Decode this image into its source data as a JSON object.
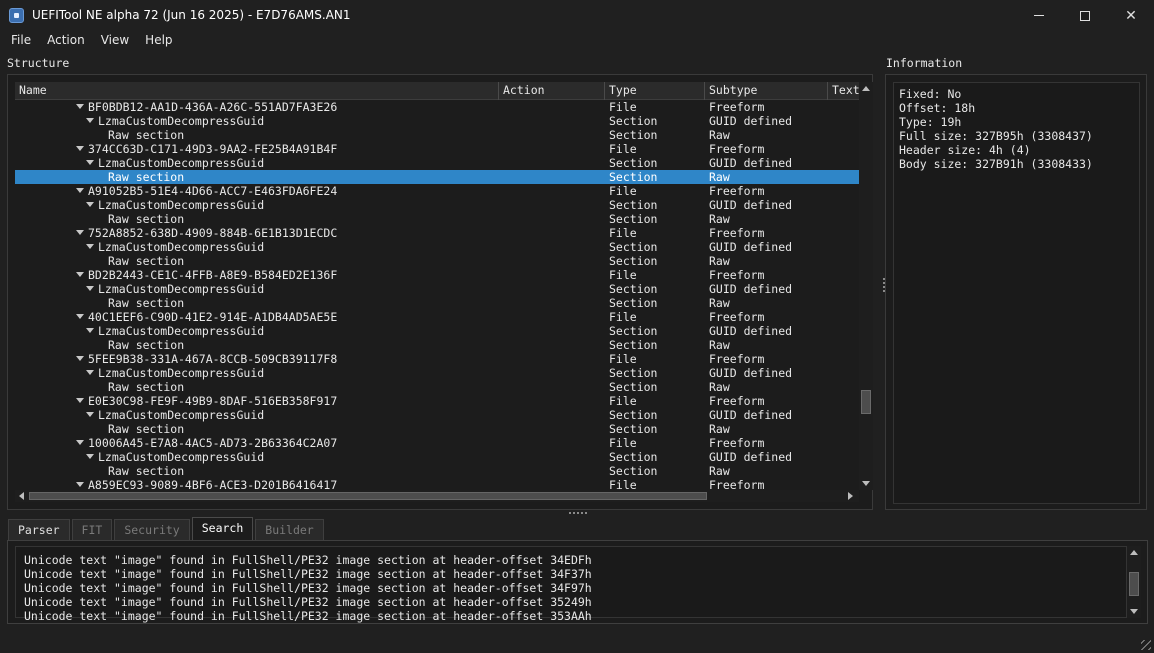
{
  "window": {
    "title": "UEFITool NE alpha 72 (Jun 16 2025) - E7D76AMS.AN1",
    "icon": "uefitool-app-icon",
    "close_glyph": "✕"
  },
  "menu": [
    "File",
    "Action",
    "View",
    "Help"
  ],
  "structure": {
    "label": "Structure",
    "columns": [
      "Name",
      "Action",
      "Type",
      "Subtype",
      "Text"
    ],
    "rows": [
      {
        "level": 1,
        "expanded": true,
        "name": "BF0BDB12-AA1D-436A-A26C-551AD7FA3E26",
        "type": "File",
        "subtype": "Freeform"
      },
      {
        "level": 2,
        "expanded": true,
        "name": "LzmaCustomDecompressGuid",
        "type": "Section",
        "subtype": "GUID defined"
      },
      {
        "level": 3,
        "expanded": false,
        "name": "Raw section",
        "type": "Section",
        "subtype": "Raw"
      },
      {
        "level": 1,
        "expanded": true,
        "name": "374CC63D-C171-49D3-9AA2-FE25B4A91B4F",
        "type": "File",
        "subtype": "Freeform"
      },
      {
        "level": 2,
        "expanded": true,
        "name": "LzmaCustomDecompressGuid",
        "type": "Section",
        "subtype": "GUID defined"
      },
      {
        "level": 3,
        "expanded": false,
        "name": "Raw section",
        "type": "Section",
        "subtype": "Raw",
        "selected": true
      },
      {
        "level": 1,
        "expanded": true,
        "name": "A91052B5-51E4-4D66-ACC7-E463FDA6FE24",
        "type": "File",
        "subtype": "Freeform"
      },
      {
        "level": 2,
        "expanded": true,
        "name": "LzmaCustomDecompressGuid",
        "type": "Section",
        "subtype": "GUID defined"
      },
      {
        "level": 3,
        "expanded": false,
        "name": "Raw section",
        "type": "Section",
        "subtype": "Raw"
      },
      {
        "level": 1,
        "expanded": true,
        "name": "752A8852-638D-4909-884B-6E1B13D1ECDC",
        "type": "File",
        "subtype": "Freeform"
      },
      {
        "level": 2,
        "expanded": true,
        "name": "LzmaCustomDecompressGuid",
        "type": "Section",
        "subtype": "GUID defined"
      },
      {
        "level": 3,
        "expanded": false,
        "name": "Raw section",
        "type": "Section",
        "subtype": "Raw"
      },
      {
        "level": 1,
        "expanded": true,
        "name": "BD2B2443-CE1C-4FFB-A8E9-B584ED2E136F",
        "type": "File",
        "subtype": "Freeform"
      },
      {
        "level": 2,
        "expanded": true,
        "name": "LzmaCustomDecompressGuid",
        "type": "Section",
        "subtype": "GUID defined"
      },
      {
        "level": 3,
        "expanded": false,
        "name": "Raw section",
        "type": "Section",
        "subtype": "Raw"
      },
      {
        "level": 1,
        "expanded": true,
        "name": "40C1EEF6-C90D-41E2-914E-A1DB4AD5AE5E",
        "type": "File",
        "subtype": "Freeform"
      },
      {
        "level": 2,
        "expanded": true,
        "name": "LzmaCustomDecompressGuid",
        "type": "Section",
        "subtype": "GUID defined"
      },
      {
        "level": 3,
        "expanded": false,
        "name": "Raw section",
        "type": "Section",
        "subtype": "Raw"
      },
      {
        "level": 1,
        "expanded": true,
        "name": "5FEE9B38-331A-467A-8CCB-509CB39117F8",
        "type": "File",
        "subtype": "Freeform"
      },
      {
        "level": 2,
        "expanded": true,
        "name": "LzmaCustomDecompressGuid",
        "type": "Section",
        "subtype": "GUID defined"
      },
      {
        "level": 3,
        "expanded": false,
        "name": "Raw section",
        "type": "Section",
        "subtype": "Raw"
      },
      {
        "level": 1,
        "expanded": true,
        "name": "E0E30C98-FE9F-49B9-8DAF-516EB358F917",
        "type": "File",
        "subtype": "Freeform"
      },
      {
        "level": 2,
        "expanded": true,
        "name": "LzmaCustomDecompressGuid",
        "type": "Section",
        "subtype": "GUID defined"
      },
      {
        "level": 3,
        "expanded": false,
        "name": "Raw section",
        "type": "Section",
        "subtype": "Raw"
      },
      {
        "level": 1,
        "expanded": true,
        "name": "10006A45-E7A8-4AC5-AD73-2B63364C2A07",
        "type": "File",
        "subtype": "Freeform"
      },
      {
        "level": 2,
        "expanded": true,
        "name": "LzmaCustomDecompressGuid",
        "type": "Section",
        "subtype": "GUID defined"
      },
      {
        "level": 3,
        "expanded": false,
        "name": "Raw section",
        "type": "Section",
        "subtype": "Raw"
      },
      {
        "level": 1,
        "expanded": true,
        "name": "A859EC93-9089-4BF6-ACE3-D201B6416417",
        "type": "File",
        "subtype": "Freeform"
      }
    ]
  },
  "information": {
    "label": "Information",
    "lines": [
      "Fixed: No",
      "Offset: 18h",
      "Type: 19h",
      "Full size: 327B95h (3308437)",
      "Header size: 4h (4)",
      "Body size: 327B91h (3308433)"
    ]
  },
  "tabs": [
    {
      "label": "Parser",
      "enabled": true,
      "active": false
    },
    {
      "label": "FIT",
      "enabled": false,
      "active": false
    },
    {
      "label": "Security",
      "enabled": false,
      "active": false
    },
    {
      "label": "Search",
      "enabled": true,
      "active": true
    },
    {
      "label": "Builder",
      "enabled": false,
      "active": false
    }
  ],
  "search_results": [
    "Unicode text \"image\" found in FullShell/PE32 image section at header-offset 34EDFh",
    "Unicode text \"image\" found in FullShell/PE32 image section at header-offset 34F37h",
    "Unicode text \"image\" found in FullShell/PE32 image section at header-offset 34F97h",
    "Unicode text \"image\" found in FullShell/PE32 image section at header-offset 35249h",
    "Unicode text \"image\" found in FullShell/PE32 image section at header-offset 353AAh"
  ],
  "colors": {
    "background": "#202020",
    "selection": "#2f86c8",
    "text": "#e8e8e8"
  }
}
